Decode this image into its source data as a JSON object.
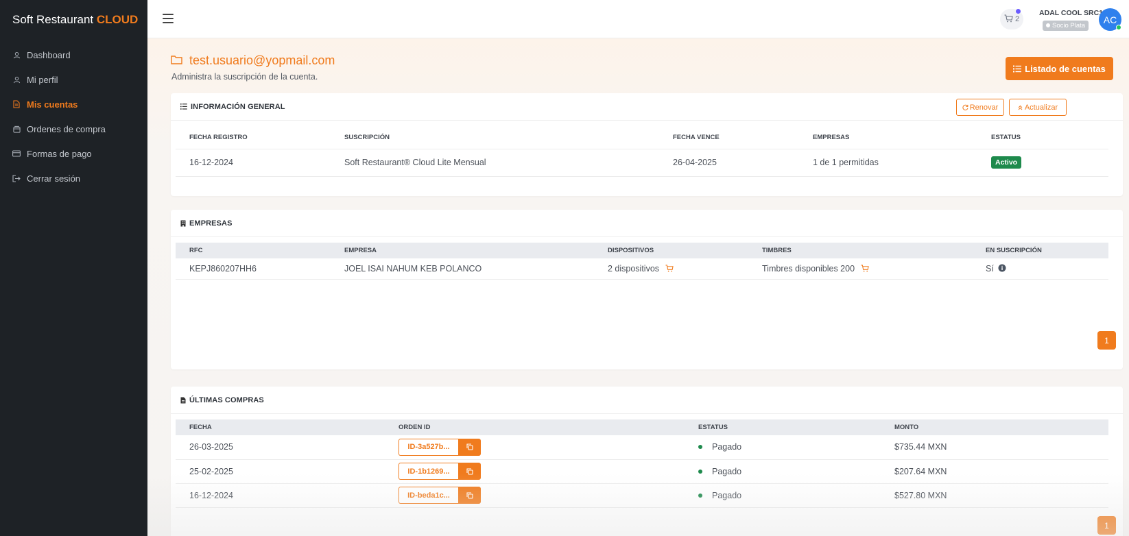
{
  "sidebar": {
    "brand_main": "Soft Restaurant",
    "brand_accent": "CLOUD",
    "items": [
      {
        "label": "Dashboard",
        "icon": "user-icon"
      },
      {
        "label": "Mi perfil",
        "icon": "user-icon"
      },
      {
        "label": "Mis cuentas",
        "icon": "document-icon",
        "active": true
      },
      {
        "label": "Ordenes de compra",
        "icon": "box-icon"
      },
      {
        "label": "Formas de pago",
        "icon": "card-icon"
      },
      {
        "label": "Cerrar sesión",
        "icon": "logout-icon"
      }
    ]
  },
  "topbar": {
    "cart_count": "2",
    "user_name": "ADAL COOL SRC1",
    "user_level": "Socio Plata",
    "avatar_initials": "AC"
  },
  "page": {
    "title": "test.usuario@yopmail.com",
    "subtitle": "Administra la suscripción de la cuenta.",
    "list_button": "Listado de cuentas"
  },
  "general_info": {
    "title": "INFORMACIÓN GENERAL",
    "renew_button": "Renovar",
    "update_button": "Actualizar",
    "headers": [
      "FECHA REGISTRO",
      "SUSCRIPCIÓN",
      "FECHA VENCE",
      "EMPRESAS",
      "ESTATUS"
    ],
    "row": {
      "registro": "16-12-2024",
      "suscripcion": "Soft Restaurant® Cloud Lite Mensual",
      "vence": "26-04-2025",
      "empresas": "1 de 1 permitidas",
      "estatus": "Activo"
    }
  },
  "empresas": {
    "title": "EMPRESAS",
    "headers": [
      "RFC",
      "EMPRESA",
      "DISPOSITIVOS",
      "TIMBRES",
      "EN SUSCRIPCIÓN"
    ],
    "row": {
      "rfc": "KEPJ860207HH6",
      "empresa": "JOEL ISAI NAHUM KEB POLANCO",
      "dispositivos": "2 dispositivos",
      "timbres": "Timbres disponibles 200",
      "en_suscripcion": "Sí"
    },
    "page": "1"
  },
  "compras": {
    "title": "ÚLTIMAS COMPRAS",
    "headers": [
      "FECHA",
      "ORDEN ID",
      "ESTATUS",
      "MONTO"
    ],
    "rows": [
      {
        "fecha": "26-03-2025",
        "orden": "ID-3a527b...",
        "estatus": "Pagado",
        "monto": "$735.44 MXN"
      },
      {
        "fecha": "25-02-2025",
        "orden": "ID-1b1269...",
        "estatus": "Pagado",
        "monto": "$207.64 MXN"
      },
      {
        "fecha": "16-12-2024",
        "orden": "ID-beda1c...",
        "estatus": "Pagado",
        "monto": "$527.80 MXN"
      }
    ],
    "page": "1"
  },
  "colors": {
    "accent": "#f07b1d",
    "sidebar_bg": "#1e2226",
    "success": "#1e8a4c",
    "avatar": "#2f80ed"
  }
}
